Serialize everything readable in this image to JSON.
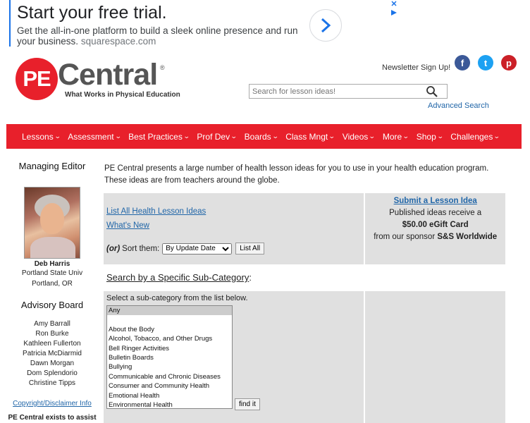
{
  "ad": {
    "title": "Start your free trial.",
    "description": "Get the all-in-one platform to build a sleek online presence and run your business.",
    "domain": "squarespace.com",
    "arrow_icon": "chevron-right-icon"
  },
  "header": {
    "logo_letters": "PE",
    "logo_word": "Central",
    "logo_reg": "®",
    "tagline": "What Works in Physical Education",
    "newsletter": "Newsletter Sign Up!",
    "social": {
      "facebook": "f",
      "twitter": "t",
      "pinterest": "p"
    },
    "search_placeholder": "Search for lesson ideas!",
    "advanced_search": "Advanced Search"
  },
  "nav": {
    "items": [
      {
        "label": "Lessons"
      },
      {
        "label": "Assessment"
      },
      {
        "label": "Best Practices"
      },
      {
        "label": "Prof Dev"
      },
      {
        "label": "Boards"
      },
      {
        "label": "Class Mngt"
      },
      {
        "label": "Videos"
      },
      {
        "label": "More"
      },
      {
        "label": "Shop"
      },
      {
        "label": "Challenges"
      }
    ],
    "chevron": "⌄"
  },
  "sidebar": {
    "editor_title": "Managing Editor",
    "editor_name": "Deb Harris",
    "editor_school": "Portland State Univ",
    "editor_city": "Portland, OR",
    "advisory_title": "Advisory Board",
    "advisory": [
      "Amy Barrall",
      "Ron Burke",
      "Kathleen Fullerton",
      "Patricia McDiarmid",
      "Dawn Morgan",
      "Dom Splendorio",
      "Christine Tipps"
    ],
    "copyright": "Copyright/Disclaimer Info",
    "exists": "PE Central exists to assist teachers and other adults"
  },
  "main": {
    "intro": "PE Central presents a large number of health lesson ideas for you to use in your health education program. These ideas are from teachers around the globe.",
    "list_all_link": "List All Health Lesson Ideas",
    "whats_new_link": "What's New",
    "or_label": "(or)",
    "sort_label": "Sort them:",
    "sort_selected": "By Update Date",
    "list_all_btn": "List All",
    "submit_link": "Submit a Lesson Idea",
    "published": "Published ideas receive a",
    "gift": "$50.00 eGift Card",
    "sponsor_prefix": "from our sponsor ",
    "sponsor": "S&S Worldwide",
    "search_heading": "Search by a Specific Sub-Category",
    "search_heading_colon": ":",
    "subcat_label": "Select a sub-category from the list below.",
    "subcategories": [
      "Any",
      "",
      "About the Body",
      "Alcohol, Tobacco, and Other Drugs",
      "Bell Ringer Activities",
      "Bulletin Boards",
      "Bullying",
      "Communicable and Chronic Diseases",
      "Consumer and Community Health",
      "Emotional Health",
      "Environmental Health"
    ],
    "find_btn": "find it"
  }
}
